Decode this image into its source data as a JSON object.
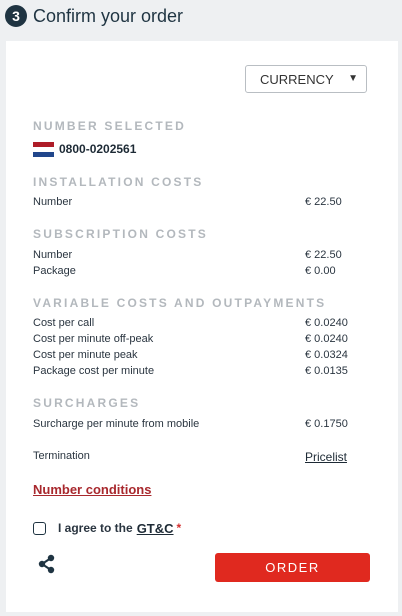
{
  "header": {
    "step_number": "3",
    "title": "Confirm your order"
  },
  "currency_select": {
    "value": "CURRENCY"
  },
  "number_selected": {
    "title": "NUMBER SELECTED",
    "number": "0800-0202561"
  },
  "installation_costs": {
    "title": "INSTALLATION COSTS",
    "rows": [
      {
        "label": "Number",
        "value": "€ 22.50"
      }
    ]
  },
  "subscription_costs": {
    "title": "SUBSCRIPTION COSTS",
    "rows": [
      {
        "label": "Number",
        "value": "€ 22.50"
      },
      {
        "label": "Package",
        "value": "€ 0.00"
      }
    ]
  },
  "variable_costs": {
    "title": "VARIABLE COSTS AND OUTPAYMENTS",
    "rows": [
      {
        "label": "Cost per call",
        "value": "€ 0.0240"
      },
      {
        "label": "Cost per minute off-peak",
        "value": "€ 0.0240"
      },
      {
        "label": "Cost per minute peak",
        "value": "€ 0.0324"
      },
      {
        "label": "Package cost per minute",
        "value": "€ 0.0135"
      }
    ]
  },
  "surcharges": {
    "title": "SURCHARGES",
    "rows": [
      {
        "label": "Surcharge per minute from mobile",
        "value": "€ 0.1750"
      }
    ]
  },
  "termination": {
    "label": "Termination",
    "link": "Pricelist"
  },
  "number_conditions_link": "Number conditions",
  "agree": {
    "text": "I agree to the",
    "link": "GT&C",
    "required_mark": "*"
  },
  "order_button": "ORDER",
  "colors": {
    "accent": "#e0291f",
    "dark": "#1f3442",
    "conditions": "#a8282d",
    "muted": "#b3b8bd"
  },
  "flag": {
    "country": "Netherlands",
    "stripes": [
      "#ae1c28",
      "#ffffff",
      "#21468b"
    ]
  }
}
